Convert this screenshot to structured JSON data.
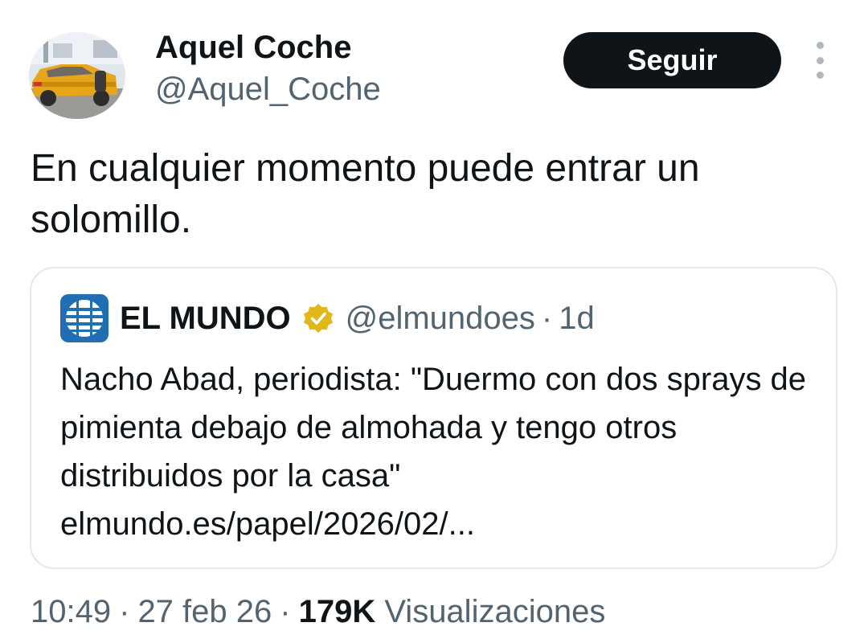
{
  "author": {
    "display_name": "Aquel Coche",
    "handle": "@Aquel_Coche",
    "avatar_icon": "yellow-car-avatar"
  },
  "actions": {
    "follow_label": "Seguir",
    "more_icon": "vertical-ellipsis-icon"
  },
  "tweet": {
    "text": "En cualquier momento puede entrar un solomillo."
  },
  "quote": {
    "name": "EL MUNDO",
    "handle": "@elmundoes",
    "separator": "·",
    "time": "1d",
    "text": "Nacho Abad, periodista: \"Duermo con dos sprays de pimienta debajo de almohada y tengo otros distribuidos por la casa\"",
    "link": "elmundo.es/papel/2026/02/...",
    "logo_icon": "el-mundo-globe-logo",
    "verified_icon": "verified-gold-badge-icon",
    "verified_color": "#E2B719"
  },
  "meta": {
    "time": "10:49",
    "sep1": "·",
    "date": "27 feb 26",
    "sep2": "·",
    "views_count": "179K",
    "views_label": "Visualizaciones"
  },
  "colors": {
    "text": "#0F1419",
    "secondary": "#536471",
    "button_bg": "#0F1419",
    "border": "#E4E8EB",
    "logo_blue": "#1F6FB2"
  }
}
